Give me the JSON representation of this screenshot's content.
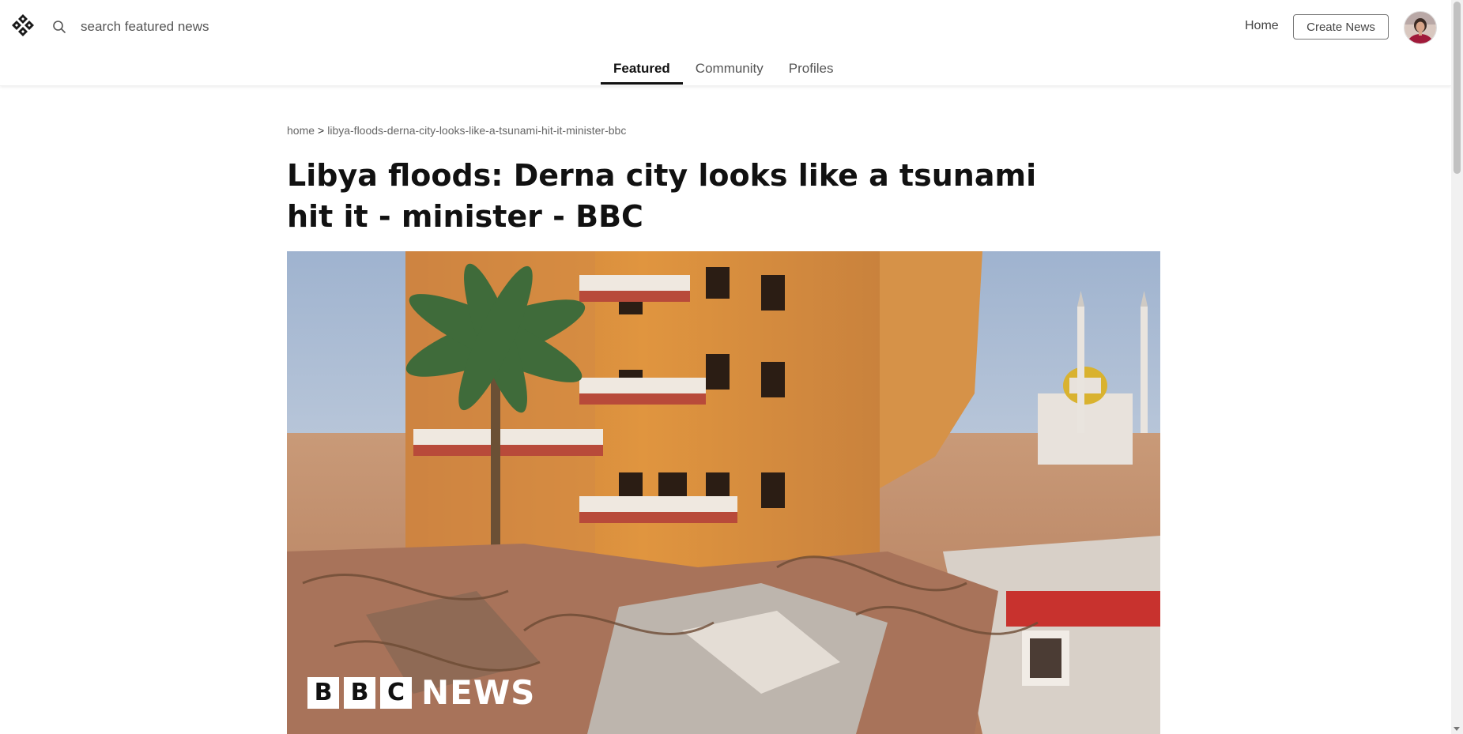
{
  "header": {
    "search_placeholder": "search featured news",
    "nav_home": "Home",
    "create_button": "Create News"
  },
  "tabs": [
    {
      "label": "Featured",
      "active": true
    },
    {
      "label": "Community",
      "active": false
    },
    {
      "label": "Profiles",
      "active": false
    }
  ],
  "breadcrumb": {
    "home": "home",
    "separator": ">",
    "slug": "libya-floods-derna-city-looks-like-a-tsunami-hit-it-minister-bbc"
  },
  "article": {
    "title": "Libya floods: Derna city looks like a tsunami hit it - minister - BBC"
  },
  "hero_image": {
    "watermark": [
      "B",
      "B",
      "C",
      "NEWS"
    ]
  },
  "icons": {
    "logo": "diamond-pattern-logo-icon",
    "search": "search-icon"
  }
}
